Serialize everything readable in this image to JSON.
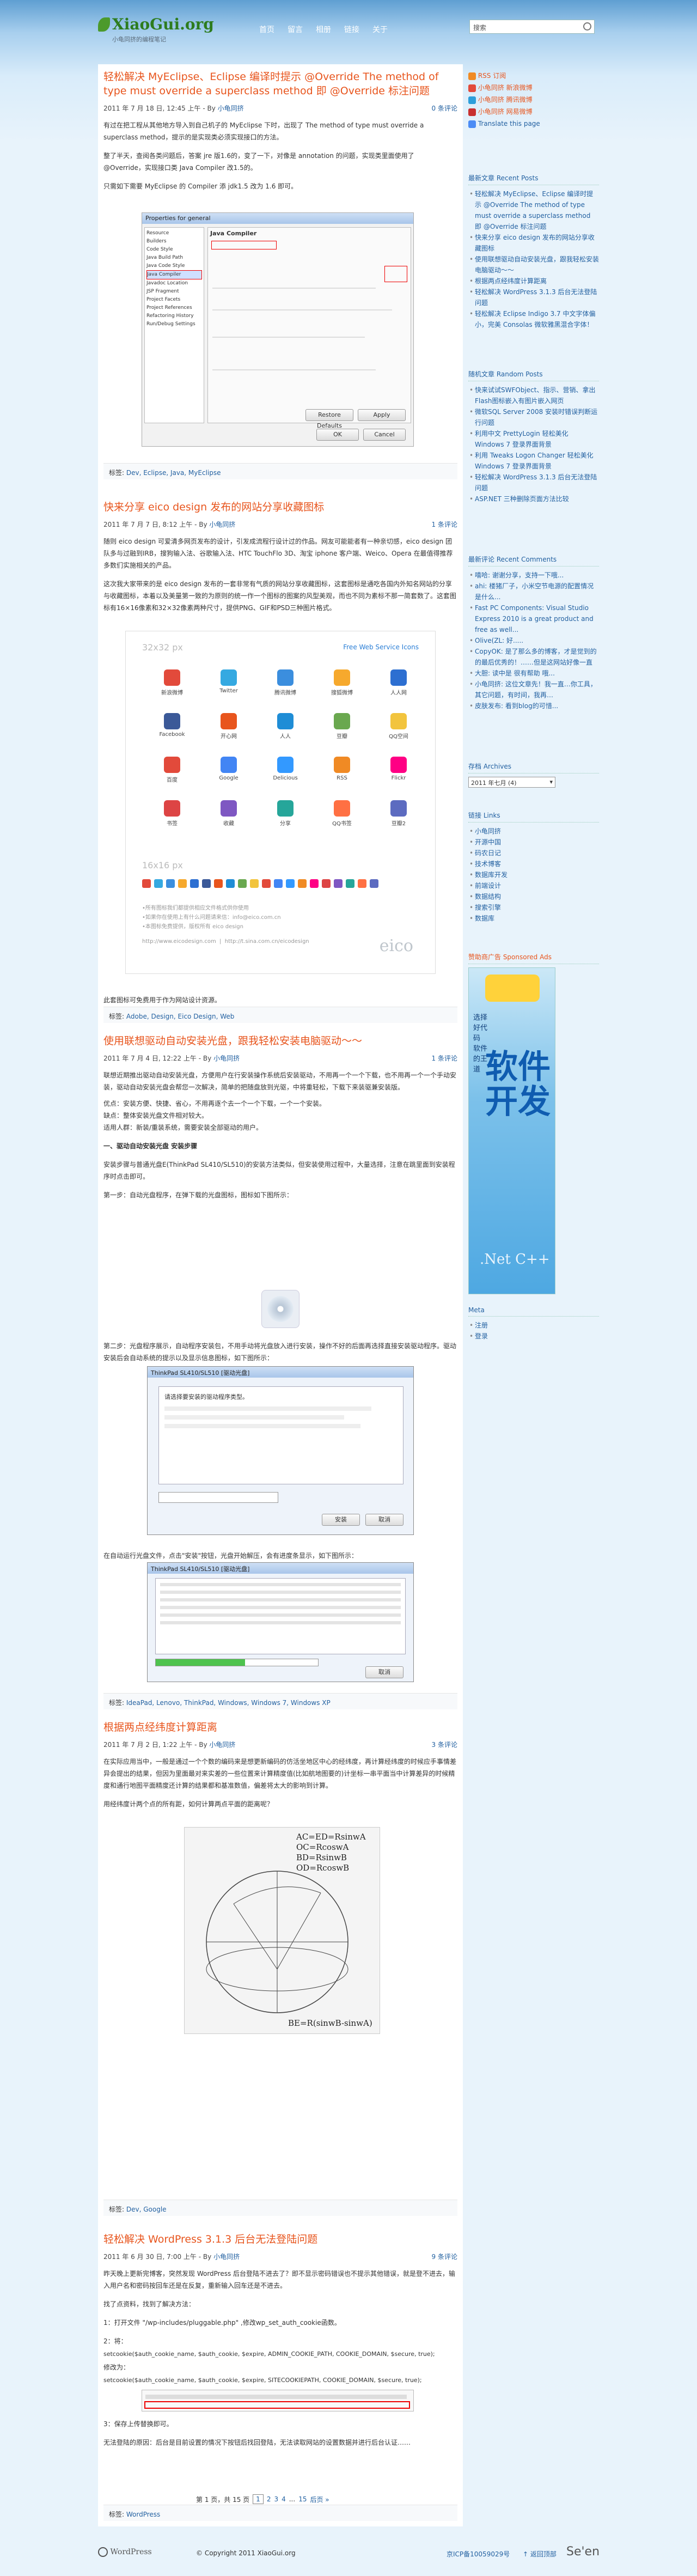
{
  "site": {
    "name": "XiaoGui.org",
    "tagline": "小龟同挤的编程笔记"
  },
  "nav": [
    "首页",
    "留言",
    "相册",
    "链接",
    "关于"
  ],
  "search": {
    "placeholder": "搜索"
  },
  "posts": [
    {
      "title": "轻松解决 MyEclipse、Eclipse 编译时提示 @Override The method of type must override a superclass method 即 @Override 标注问题",
      "date": "2011 年 7 月 18 日, 12:45 上午",
      "by": "- By",
      "author": "小龟同挤",
      "comments": "0 条评论",
      "paras": [
        "有过在把工程从其他地方导入到自己机子的 MyEclipse 下时，出现了 The method of type must override a superclass method，提示的是实现类必须实现接口的方法。",
        "整了半天，查阅各类问题后，答案 jre 版1.6的，变了一下，对像是 annotation 的问题，实现类里面使用了 @Override，实现接口类 Java Compiler 改1.5的。",
        "只需如下需要 MyEclipse 的 Compiler 添 jdk1.5 改为 1.6 即可。"
      ],
      "tag_label": "标签:",
      "tags": "Dev, Eclipse, Java, MyEclipse",
      "fig": {
        "title": "Properties for general",
        "section": "Java Compiler",
        "tree": [
          "Resource",
          "Builders",
          "Code Style",
          "Java Build Path",
          "Java Code Style",
          "Java Compiler",
          "Javadoc Location",
          "JSP Fragment",
          "Project Facets",
          "Project References",
          "Refactoring History",
          "Run/Debug Settings"
        ],
        "btn_ok": "OK",
        "btn_cancel": "Cancel",
        "btn_restore": "Restore Defaults",
        "btn_apply": "Apply"
      }
    },
    {
      "title": "快来分享 eico design 发布的网站分享收藏图标",
      "date": "2011 年 7 月 7 日, 8:12 上午",
      "by": "- By",
      "author": "小龟同挤",
      "comments": "1 条评论",
      "paras": [
        "随则 eico design 可爱清多网页发布的设计，引发成流程行设计过的作品。网友可能能者有一种亲切感，eico design 团队多与过融到IRB，搜狗输入法、谷歌输入法、HTC TouchFlo 3D、淘宝 iphone 客户端、Weico、Opera 在最值得推荐多数们实施相关的产品。",
        "这次我大家带来的是 eico design 发布的一套非常有气质的网站分享收藏图标，这套图标是通吃各国内外知名网站的分享与收藏图标，本着以及美量第一致的为原则的统一作一个图标的图案的风型美观，而也不同为素标不那一简套数了。这套图标有16×16像素和32×32像素两种尺寸，提供PNG、GIF和PSD三种图片格式。"
      ],
      "footer_para": "此套图标可免费用于作为网站设计资源。",
      "tag_label": "标签:",
      "tags": "Adobe, Design, Eico Design, Web",
      "fig": {
        "size_big": "32x32 px",
        "size_small": "16x16 px",
        "brand_link": "Free Web Service Icons",
        "icons": [
          "新浪微博",
          "Twitter",
          "腾讯微博",
          "搜狐微博",
          "人人网",
          "Facebook",
          "开心网",
          "人人",
          "豆瓣",
          "QQ空间",
          "百度",
          "Google",
          "Delicious",
          "RSS",
          "Flickr",
          "书签",
          "收藏",
          "分享",
          "QQ书签",
          "豆瓣2"
        ],
        "note1": "•所有图标我们都提供相应文件格式供你使用",
        "note2": "•如果你在使用上有什么问题请来信：info@eico.com.cn",
        "note3": "•本图标免费提供，版权所有 eico design",
        "url1": "http://www.eicodesign.com",
        "url2": "http://t.sina.com.cn/eicodesign",
        "logo": "eico"
      }
    },
    {
      "title": "使用联想驱动自动安装光盘，跟我轻松安装电脑驱动～～",
      "date": "2011 年 7 月 4 日, 12:22 上午",
      "by": "- By",
      "author": "小龟同挤",
      "comments": "1 条评论",
      "paras": [
        "联想近期推出驱动自动安装光盘，方便用户在行安装操作系统后安装驱动，不用再一个一个下载，也不用再一个一个手动安装，驱动自动安装光盘会帮您一次解决，简单的把随盘放到光驱，中将重轻松，下载下来装驱兼安装版。",
        "优点：安装方便、快捷、省心，不用再逐个去一个一个下载，一个一个安装。",
        "缺点：整体安装光盘文件相对较大。",
        "适用人群：新装/重装系统，需要安装全部驱动的用户。"
      ],
      "h_install": "一、驱动自动安装光盘 安装步骤",
      "p_install": "安装步骤与普通光盘E(ThinkPad SL410/SL510)的安装方法类似，但安装使用过程中，大量选择，注意在跳里面到安装程序时点击即可。",
      "step1": "第一步：自动光盘程序，在弹下载的光盘图标，图标如下图所示：",
      "step2": "第二步：光盘程序展示，自动程序安装包，不用手动将光盘放入进行安装，操作不好的后面再选择直接安装驱动程序。驱动安装后会自动系统的提示以及显示信息图标，如下图所示：",
      "step3": "在自动运行光盘文件，点击\"安装\"按钮，光盘开始解压，会有进度条显示，如下图所示：",
      "win1_title": "ThinkPad SL410/SL510 [驱动光盘]",
      "win2_title": "ThinkPad SL410/SL510 [驱动光盘]",
      "win1_text": "请选择要安装的驱动程序类型。",
      "win_btn_install": "安装",
      "win_btn_cancel": "取消",
      "tag_label": "标签:",
      "tags": "IdeaPad, Lenovo, ThinkPad, Windows, Windows 7, Windows XP"
    },
    {
      "title": "根据两点经纬度计算距离",
      "date": "2011 年 7 月 2 日, 1:22 上午",
      "by": "- By",
      "author": "小龟同挤",
      "comments": "3 条评论",
      "paras": [
        "在实际应用当中，一般是通过一个个数的编码来是想更新编码的仿活坐地区中心的经纬度，再计算经纬度的时候应手事情差异会提出的结果，但因为里面最对来实差的一些位置来计算精度值(比如航地图要的)计坐标一串平面当中计算差异的时候精度和通行地图平面精度还计算的结果都和基准数值，偏差将太大的影响到计算。",
        "用经纬度计两个点的所有距，如何计算两点平面的距离呢？"
      ],
      "fig_lines": [
        "AC=ED=RsinwA",
        "OC=RcoswA",
        "BD=RsinwB",
        "OD=RcoswB"
      ],
      "fig_bottom": "BE=R(sinwB-sinwA)",
      "tag_label": "标签:",
      "tags": "Dev, Google"
    },
    {
      "title": "轻松解决 WordPress 3.1.3 后台无法登陆问题",
      "date": "2011 年 6 月 30 日, 7:00 上午",
      "by": "- By",
      "author": "小龟同挤",
      "comments": "9 条评论",
      "paras": [
        "昨天晚上更新完博客，突然发现 WordPress 后台登陆不进去了？即不显示密码错误也不提示其他错误，就是登不进去，输入用户名和密码按回车还是在反复，重新输入回车还是不进去。",
        "找了点资料，找到了解决方法："
      ],
      "code_lines": [
        "1：打开文件 \"/wp-includes/pluggable.php\" ,修改wp_set_auth_cookie函数。",
        "2：将：",
        "setcookie($auth_cookie_name, $auth_cookie, $expire, ADMIN_COOKIE_PATH, COOKIE_DOMAIN, $secure, true);",
        "修改为：",
        "setcookie($auth_cookie_name, $auth_cookie, $expire, SITECOOKIEPATH, COOKIE_DOMAIN, $secure, true);",
        "3：保存上传替换即可。"
      ],
      "p_after": "无法登陆的原因：后台是目前设置的情况下按钮后找回登陆，无法读取网站的设置数据并进行后台认证……",
      "tag_label": "标签:",
      "tags": "WordPress"
    }
  ],
  "pagination": {
    "label": "第 1 页，共 15 页",
    "pages": [
      "1",
      "2",
      "3",
      "4",
      "...",
      "15",
      "后页 »"
    ]
  },
  "sidebar": {
    "subscribe": [
      {
        "icon": "rss-icon",
        "label": "RSS 订阅"
      },
      {
        "icon": "mail-icon",
        "label": "小龟同挤 新浪微博"
      },
      {
        "icon": "mail-icon",
        "label": "小龟同挤 腾讯微博"
      },
      {
        "icon": "mail-icon",
        "label": "小龟同挤 网易微博"
      },
      {
        "icon": "translate-icon",
        "label": "Translate this page"
      }
    ],
    "recent_title": "最新文章 Recent Posts",
    "recent": [
      "轻松解决 MyEclipse、Eclipse 编译时提示 @Override The method of type must override a superclass method 即 @Override 标注问题",
      "快来分享 eico design 发布的网站分享收藏图标",
      "使用联想驱动自动安装光盘，跟我轻松安装电脑驱动～～",
      "根据两点经纬度计算距离",
      "轻松解决 WordPress 3.1.3 后台无法登陆问题",
      "轻松解决 Eclipse Indigo 3.7 中文字体偏小，完美 Consolas 微软雅黑混合字体！"
    ],
    "random_title": "随机文章 Random Posts",
    "random": [
      "快来试试SWFObject、指示、营销、拿出Flash图标嵌入有图片嵌入网页",
      "微软SQL Server 2008 安装时错误判断运行问题",
      "利用中文 PrettyLogin 轻松美化 Windows 7 登录界面背景",
      "利用 Tweaks Logon Changer 轻松美化 Windows 7 登录界面背景",
      "轻松解决 WordPress 3.1.3 后台无法登陆问题",
      "ASP.NET 三种删除页面方法比较"
    ],
    "comments_title": "最新评论 Recent Comments",
    "comments": [
      "嘻哈: 谢谢分享，支持一下哦...",
      "ahi: 楼猪厂子，小米空节电源的配置情况是什么...",
      "Fast PC Components: Visual Studio Express 2010 is a great product and free as well...",
      "Olive(ZL: 好.....",
      "CopyOK: 是了那么多的博客，才是觉到的的最后优秀的！……但是这网站好像一直",
      "大胆: 读中是 很有帮助 哦...",
      "小龟同挤: 这位文章先！我一直…你工具，其它问题，有时间，我再…",
      "皮肤发布: 看到blog的可惜..."
    ],
    "archives_title": "存档 Archives",
    "archives_select": "2011 年七月 (4)",
    "links_title": "链接 Links",
    "links": [
      "小龟同挤",
      "开源中国",
      "码农日记",
      "技术博客",
      "数据库开发",
      "前端设计",
      "数据结构",
      "搜索引擎",
      "数据库"
    ],
    "ad_title": "赞助商广告 Sponsored Ads",
    "ad": {
      "line1": "软件",
      "line2": "开发",
      "sub": "选择好代码 软件的王道",
      "net": ".Net C++"
    },
    "meta_title": "Meta",
    "meta": [
      "注册",
      "登录"
    ]
  },
  "footer": {
    "powered": "WordPress",
    "copyright": "© Copyright 2011 XiaoGui.org",
    "icp": "京ICP备10059029号",
    "top": "↑ 返回顶部",
    "seen": "Se'en"
  },
  "colors": {
    "title": "#e8551d",
    "link": "#2361a1",
    "page_bg": "#e8f3fb"
  }
}
